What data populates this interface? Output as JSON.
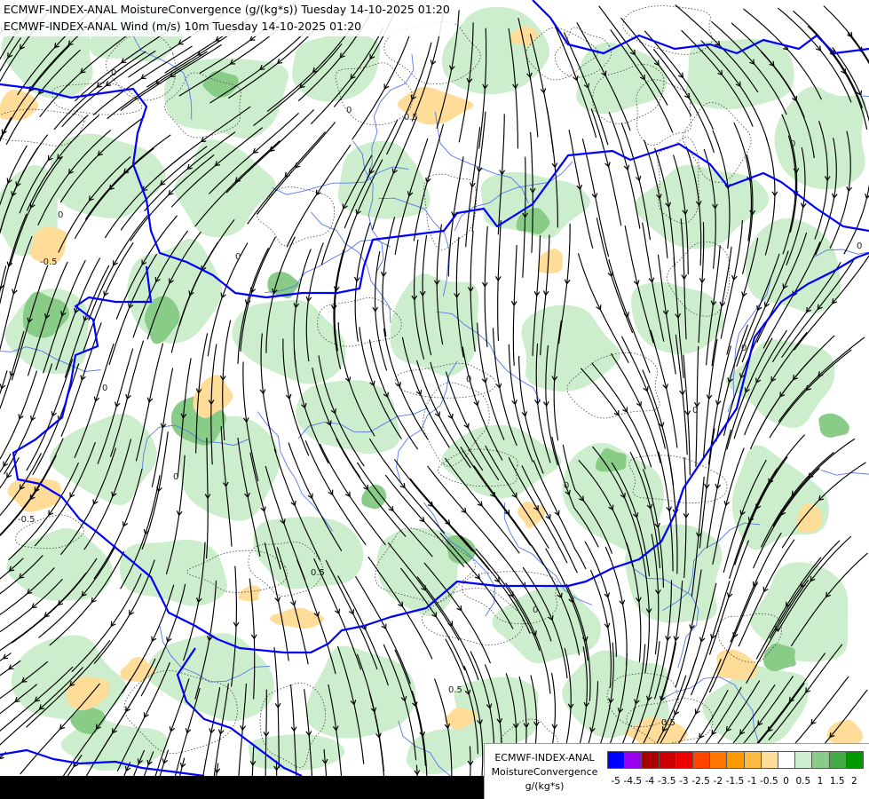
{
  "titles": {
    "line1": "ECMWF-INDEX-ANAL MoistureConvergence (g/(kg*s)) Tuesday 14-10-2025 01:20",
    "line2": "ECMWF-INDEX-ANAL Wind (m/s) 10m Tuesday 14-10-2025 01:20"
  },
  "legend": {
    "model": "ECMWF-INDEX-ANAL",
    "parameter": "MoistureConvergence",
    "unit": "g/(kg*s)",
    "ticks": [
      "-5",
      "-4.5",
      "-4",
      "-3.5",
      "-3",
      "-2.5",
      "-2",
      "-1.5",
      "-1",
      "-0.5",
      "0",
      "0.5",
      "1",
      "1.5",
      "2"
    ],
    "colors": [
      "#0000ff",
      "#9900ee",
      "#aa0000",
      "#cc0000",
      "#ee0000",
      "#ff4400",
      "#ff7700",
      "#ff9900",
      "#ffbb44",
      "#ffdd99",
      "#ffffff",
      "#cceecc",
      "#88cc88",
      "#44aa44",
      "#009900"
    ]
  },
  "contour_labels": [
    "0",
    "0",
    "0",
    "0",
    "0",
    "0",
    "0",
    "0",
    "0",
    "0",
    "0",
    "0",
    "0",
    "0.5",
    "-0.5",
    "-0.5",
    "0.5",
    "0.5",
    "0.5"
  ],
  "colors": {
    "border": "#0000ff",
    "river": "#5577ee",
    "streamline": "#000000",
    "convergence_light": "#cceecc",
    "convergence_mid": "#88cc88",
    "divergence_light": "#ffdd99"
  }
}
